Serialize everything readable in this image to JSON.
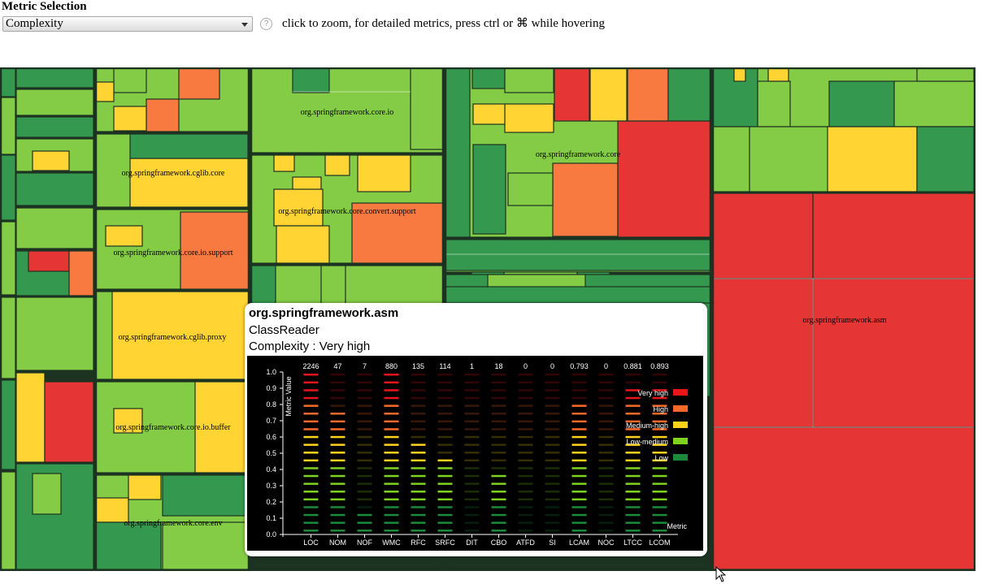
{
  "header": {
    "title": "Metric Selection",
    "selected_metric": "Complexity",
    "help_glyph": "?",
    "hint": "click to zoom, for detailed metrics, press ctrl or ⌘ while hovering"
  },
  "colors": {
    "very_high": "#e53535",
    "high": "#f97a40",
    "medium_high": "#ffd433",
    "low_medium": "#84cc46",
    "low": "#34994f",
    "border": "#1d3321"
  },
  "treemap": {
    "packages": [
      "org.springframework.cglib.core",
      "org.springframework.core.io.support",
      "org.springframework.cglib.proxy",
      "org.springframework.core.io.buffer",
      "org.springframework.core.env",
      "org.springframework.core.io",
      "org.springframework.core.convert.support",
      "org.springframework.core",
      "org.springframework.asm"
    ]
  },
  "tooltip": {
    "package": "org.springframework.asm",
    "class_name": "ClassReader",
    "metric_line": "Complexity : Very high",
    "chart_data": {
      "type": "bar",
      "ylabel": "Metric Value",
      "xlabel": "Metric",
      "ylim": [
        0,
        1
      ],
      "yticks": [
        "0.0",
        "0.1",
        "0.2",
        "0.3",
        "0.4",
        "0.5",
        "0.6",
        "0.7",
        "0.8",
        "0.9",
        "1.0"
      ],
      "categories": [
        "LOC",
        "NOM",
        "NOF",
        "WMC",
        "RFC",
        "SRFC",
        "DIT",
        "CBO",
        "ATFD",
        "SI",
        "LCAM",
        "NOC",
        "LTCC",
        "LCOM"
      ],
      "raw_values": [
        "2246",
        "47",
        "7",
        "880",
        "135",
        "114",
        "1",
        "18",
        "0",
        "0",
        "0.793",
        "0",
        "0.881",
        "0.893"
      ],
      "values": [
        1.0,
        0.75,
        0.1,
        1.0,
        0.55,
        0.45,
        0.0,
        0.35,
        0.0,
        0.0,
        0.8,
        0.0,
        0.9,
        0.9
      ],
      "legend": [
        {
          "label": "Very high",
          "color": "#e8151b"
        },
        {
          "label": "High",
          "color": "#f96a2a"
        },
        {
          "label": "Medium-high",
          "color": "#ffd21c"
        },
        {
          "label": "Low-medium",
          "color": "#7ed321"
        },
        {
          "label": "Low",
          "color": "#1b8a3a"
        }
      ]
    }
  }
}
